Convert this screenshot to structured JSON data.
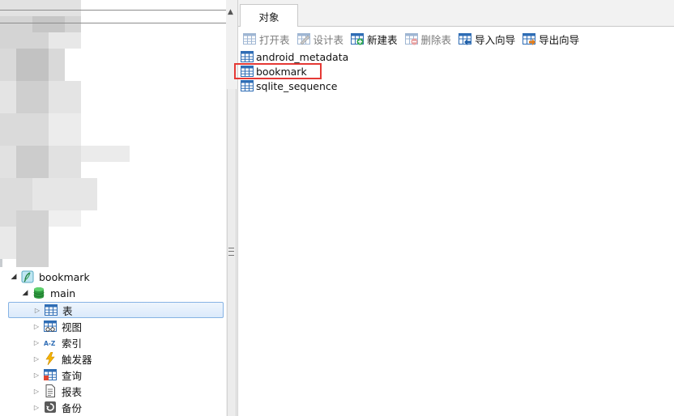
{
  "navigator": {
    "connection": {
      "label": "bookmark",
      "icon": "sqlite-feather-icon"
    },
    "database": {
      "label": "main",
      "icon": "database-icon"
    },
    "categories": [
      {
        "label": "表",
        "icon": "table-icon",
        "selected": true
      },
      {
        "label": "视图",
        "icon": "view-icon",
        "selected": false
      },
      {
        "label": "索引",
        "icon": "index-az-icon",
        "selected": false
      },
      {
        "label": "触发器",
        "icon": "trigger-bolt-icon",
        "selected": false
      },
      {
        "label": "查询",
        "icon": "query-icon",
        "selected": false
      },
      {
        "label": "报表",
        "icon": "report-icon",
        "selected": false
      },
      {
        "label": "备份",
        "icon": "backup-icon",
        "selected": false
      }
    ]
  },
  "tabs": {
    "objects": "对象"
  },
  "toolbar": {
    "open_table": "打开表",
    "design_table": "设计表",
    "new_table": "新建表",
    "delete_table": "删除表",
    "import_wizard": "导入向导",
    "export_wizard": "导出向导"
  },
  "objects": [
    {
      "name": "android_metadata"
    },
    {
      "name": "bookmark",
      "highlighted": true
    },
    {
      "name": "sqlite_sequence"
    }
  ],
  "colors": {
    "highlight_border": "#e53935",
    "selection_border": "#86b3e4",
    "table_icon_blue": "#2f6db5"
  }
}
